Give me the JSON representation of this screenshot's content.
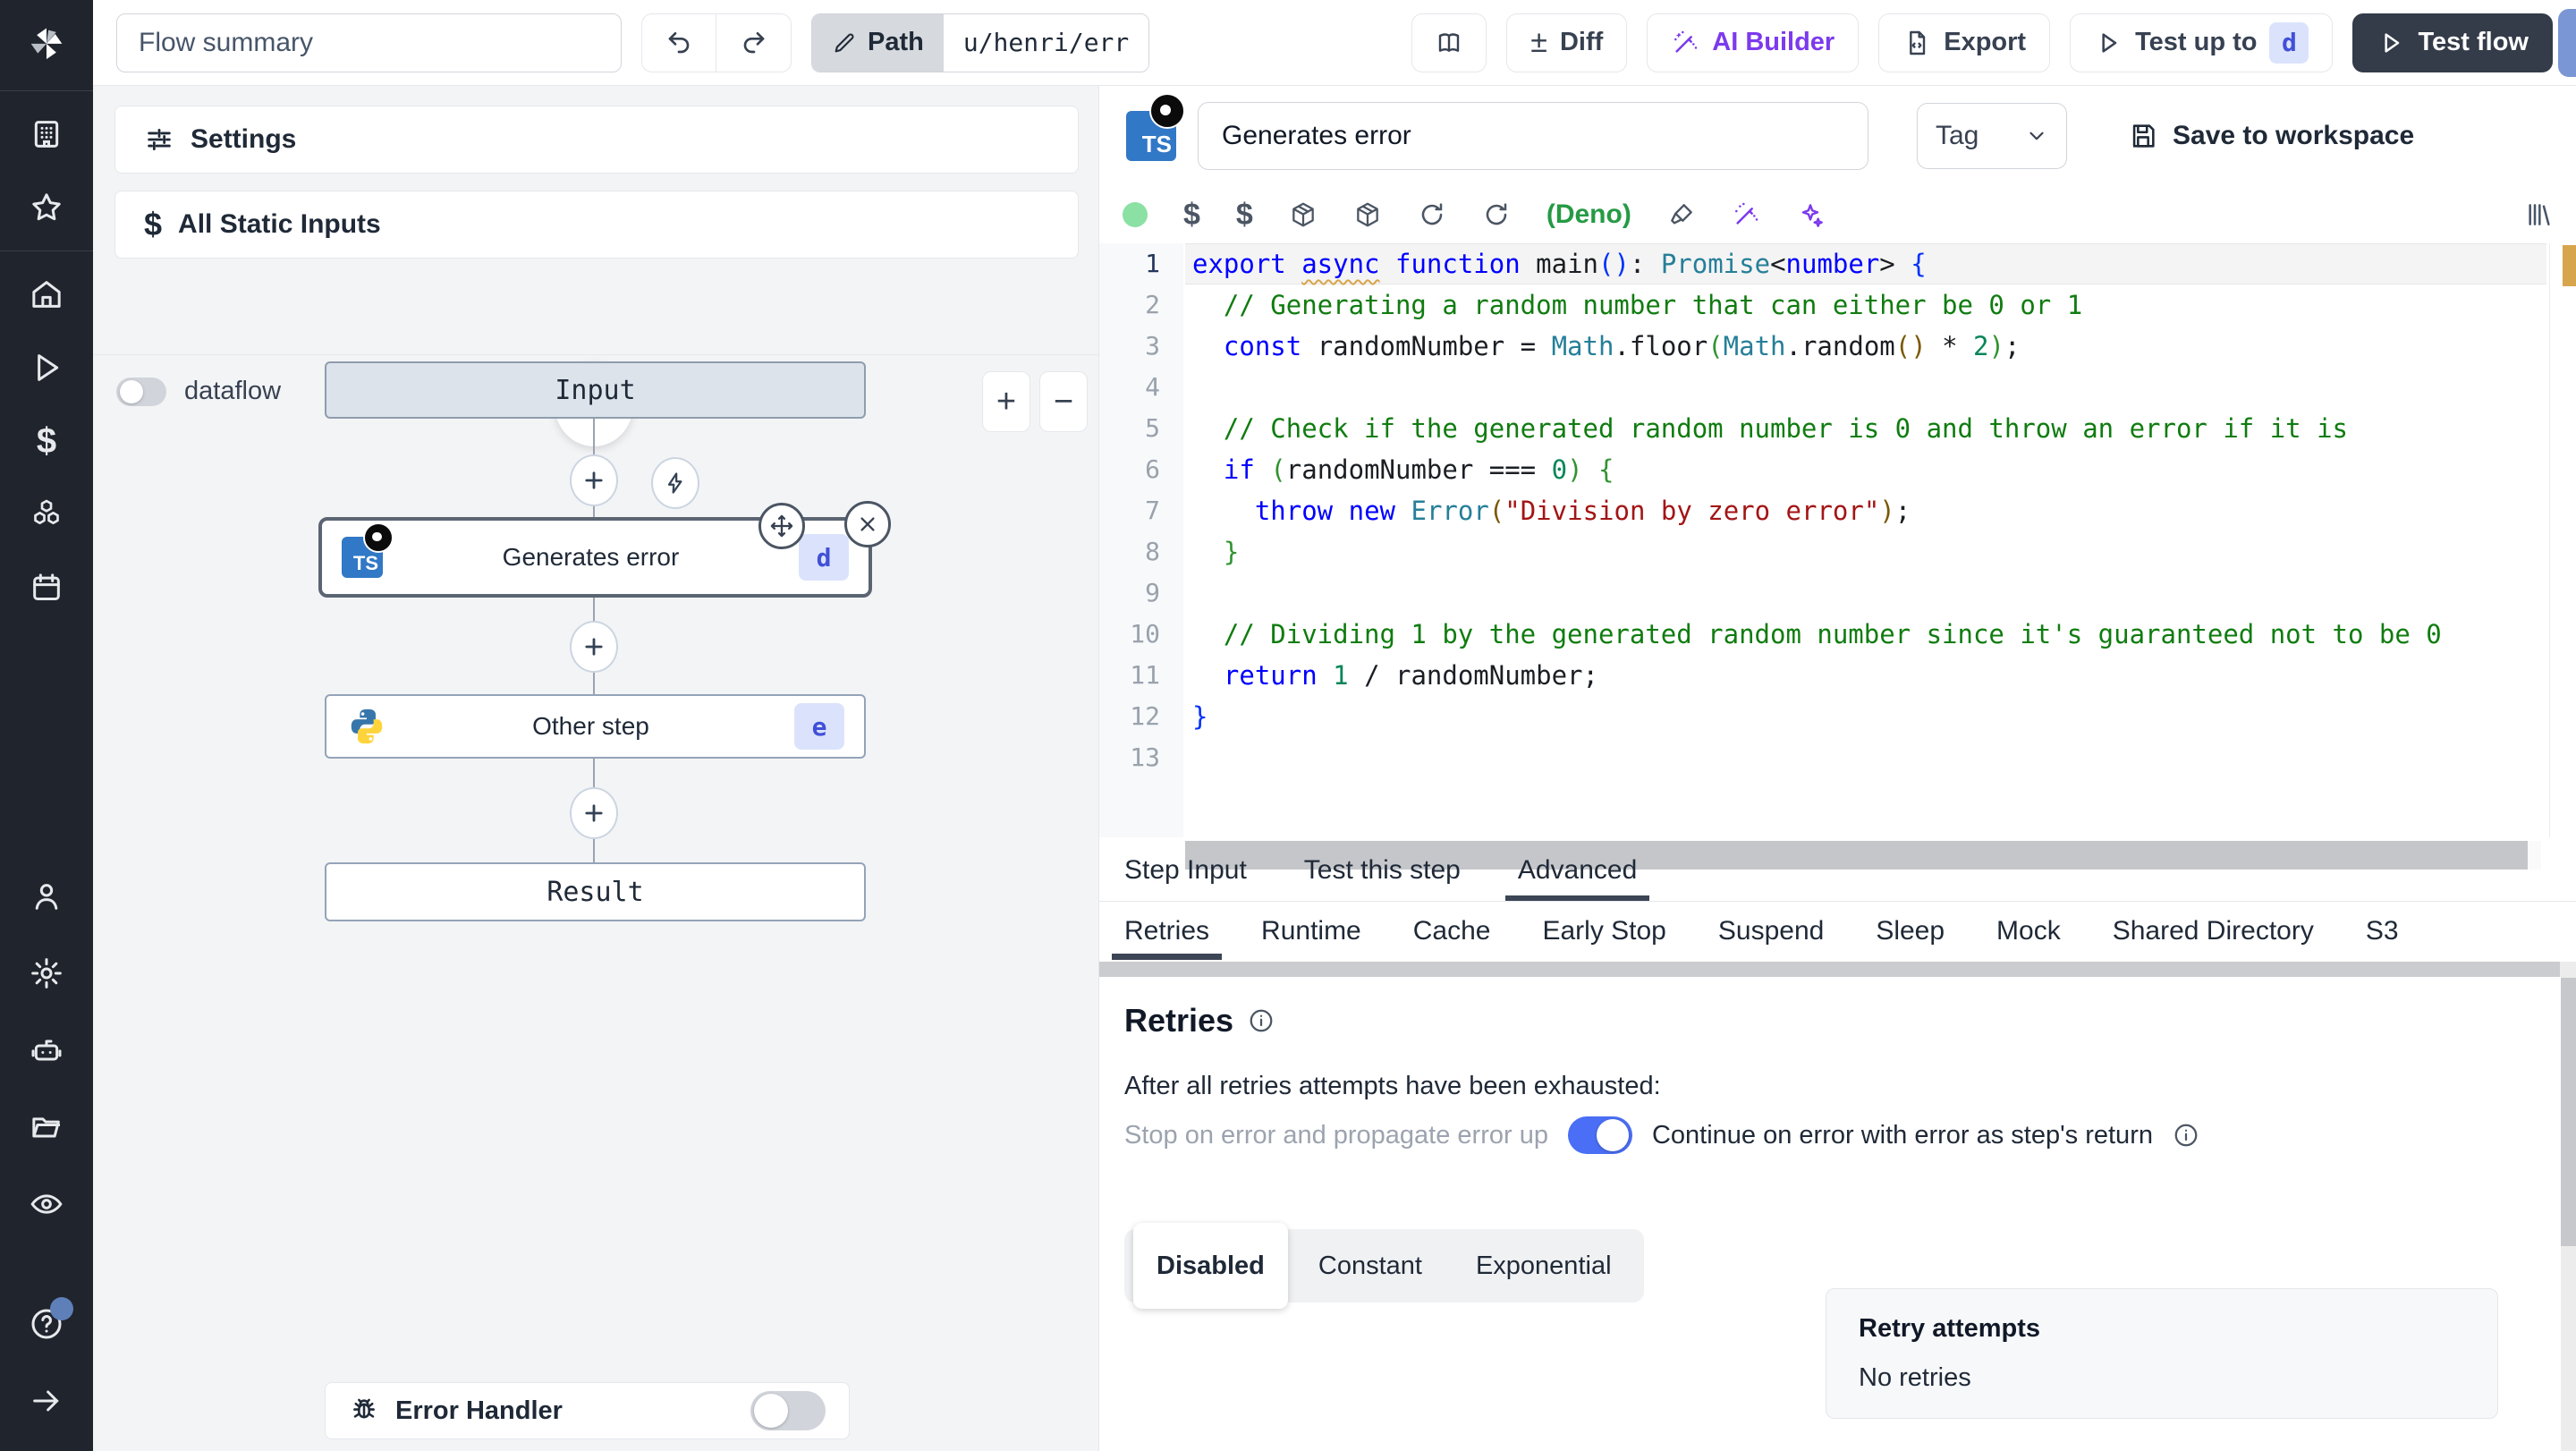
{
  "topbar": {
    "flow_summary_value": "Flow summary",
    "path_label": "Path",
    "path_value": "u/henri/err",
    "plus_minus": "±",
    "diff_label": "Diff",
    "ai_builder_label": "AI Builder",
    "export_label": "Export",
    "test_up_to_label": "Test up to",
    "test_up_to_badge": "d",
    "test_flow_label": "Test flow"
  },
  "sidebar": {
    "icons": [
      "windmill-logo",
      "workspace",
      "favorites",
      "home",
      "runs",
      "variables",
      "resources",
      "schedules",
      "user",
      "settings",
      "workers",
      "folders",
      "audit-logs",
      "help",
      "expand"
    ]
  },
  "flow": {
    "settings_label": "Settings",
    "static_inputs_label": "All Static Inputs",
    "dataflow_label": "dataflow",
    "input_node": "Input",
    "step1_title": "Generates error",
    "step1_badge": "d",
    "step2_title": "Other step",
    "step2_badge": "e",
    "result_node": "Result",
    "error_handler_label": "Error Handler"
  },
  "step": {
    "name_value": "Generates error",
    "tag_placeholder": "Tag",
    "save_label": "Save to workspace",
    "lang_label": "(Deno)"
  },
  "editor": {
    "active_line": 1,
    "lines": [
      [
        [
          "kw",
          "export "
        ],
        [
          "kwW",
          "async"
        ],
        [
          "pl",
          " "
        ],
        [
          "kw",
          "function"
        ],
        [
          "pl",
          " main"
        ],
        [
          "b1",
          "()"
        ],
        [
          "pl",
          ": "
        ],
        [
          "ty",
          "Promise"
        ],
        [
          "pl",
          "<"
        ],
        [
          "kw",
          "number"
        ],
        [
          "pl",
          "> "
        ],
        [
          "b1",
          "{"
        ]
      ],
      [
        [
          "cm",
          "  // Generating a random number that can either be 0 or 1"
        ]
      ],
      [
        [
          "pl",
          "  "
        ],
        [
          "kw",
          "const"
        ],
        [
          "pl",
          " randomNumber = "
        ],
        [
          "ty",
          "Math"
        ],
        [
          "pl",
          ".floor"
        ],
        [
          "b2",
          "("
        ],
        [
          "ty",
          "Math"
        ],
        [
          "pl",
          ".random"
        ],
        [
          "b3",
          "()"
        ],
        [
          "pl",
          " * "
        ],
        [
          "nu",
          "2"
        ],
        [
          "b2",
          ")"
        ],
        [
          "pl",
          ";"
        ]
      ],
      [],
      [
        [
          "cm",
          "  // Check if the generated random number is 0 and throw an error if it is"
        ]
      ],
      [
        [
          "pl",
          "  "
        ],
        [
          "kw",
          "if"
        ],
        [
          "pl",
          " "
        ],
        [
          "b2",
          "("
        ],
        [
          "pl",
          "randomNumber === "
        ],
        [
          "nu",
          "0"
        ],
        [
          "b2",
          ")"
        ],
        [
          "pl",
          " "
        ],
        [
          "b2",
          "{"
        ]
      ],
      [
        [
          "pl",
          "    "
        ],
        [
          "kw",
          "throw"
        ],
        [
          "pl",
          " "
        ],
        [
          "kw",
          "new"
        ],
        [
          "pl",
          " "
        ],
        [
          "ty",
          "Error"
        ],
        [
          "b3",
          "("
        ],
        [
          "st",
          "\"Division by zero error\""
        ],
        [
          "b3",
          ")"
        ],
        [
          "pl",
          ";"
        ]
      ],
      [
        [
          "pl",
          "  "
        ],
        [
          "b2",
          "}"
        ]
      ],
      [],
      [
        [
          "cm",
          "  // Dividing 1 by the generated random number since it's guaranteed not to be 0"
        ]
      ],
      [
        [
          "pl",
          "  "
        ],
        [
          "kw",
          "return"
        ],
        [
          "pl",
          " "
        ],
        [
          "nu",
          "1"
        ],
        [
          "pl",
          " / randomNumber;"
        ]
      ],
      [
        [
          "b1",
          "}"
        ]
      ],
      []
    ]
  },
  "tabs": {
    "main": [
      "Step Input",
      "Test this step",
      "Advanced"
    ],
    "main_active": 2,
    "advanced": [
      "Retries",
      "Runtime",
      "Cache",
      "Early Stop",
      "Suspend",
      "Sleep",
      "Mock",
      "Shared Directory",
      "S3"
    ],
    "advanced_active": 0
  },
  "retries": {
    "title": "Retries",
    "exhausted_text": "After all retries attempts have been exhausted:",
    "stop_label": "Stop on error and propagate error up",
    "continue_label": "Continue on error with error as step's return",
    "continue_on": true,
    "modes": [
      "Disabled",
      "Constant",
      "Exponential"
    ],
    "mode_active": 0,
    "retry_attempts_label": "Retry attempts",
    "retry_attempts_value": "No retries"
  },
  "colors": {
    "accent_toggle_on": "#4a6ef5",
    "badge_bg": "#dbe3fc",
    "badge_text": "#4150d8",
    "dark_button": "#343b49",
    "ai_purple": "#7c3aed",
    "deno_green": "#259a44",
    "sidebar_bg": "#1f242d",
    "canvas_bg": "#f3f4f6"
  }
}
